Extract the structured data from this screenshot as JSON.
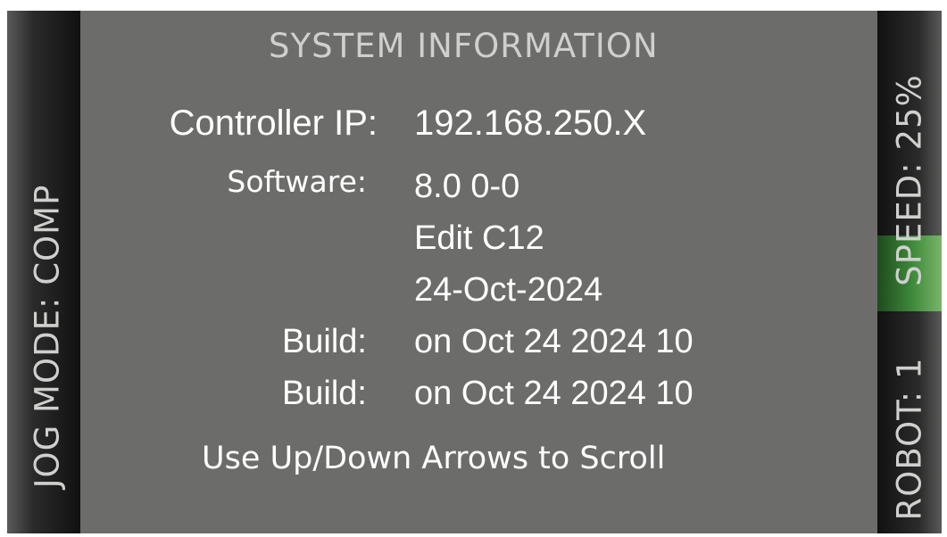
{
  "header": {
    "title": "SYSTEM INFORMATION"
  },
  "side": {
    "jog_mode": "JOG MODE: COMP",
    "speed": "SPEED: 25%",
    "robot": "ROBOT: 1"
  },
  "info": {
    "controller_ip_label": "Controller IP:",
    "controller_ip_value": "192.168.250.X",
    "software_label": "Software:",
    "software_version": "8.0 0-0",
    "software_edit": "Edit C12",
    "software_date": "24-Oct-2024",
    "build1_label": "Build:",
    "build1_value": "on Oct 24 2024 10",
    "build2_label": "Build:",
    "build2_value": "on Oct 24 2024 10"
  },
  "footer": {
    "hint": "Use Up/Down Arrows to Scroll"
  },
  "colors": {
    "background": "#6c6d6b",
    "speed_highlight": "#3f8a3a",
    "text": "#ffffff"
  }
}
